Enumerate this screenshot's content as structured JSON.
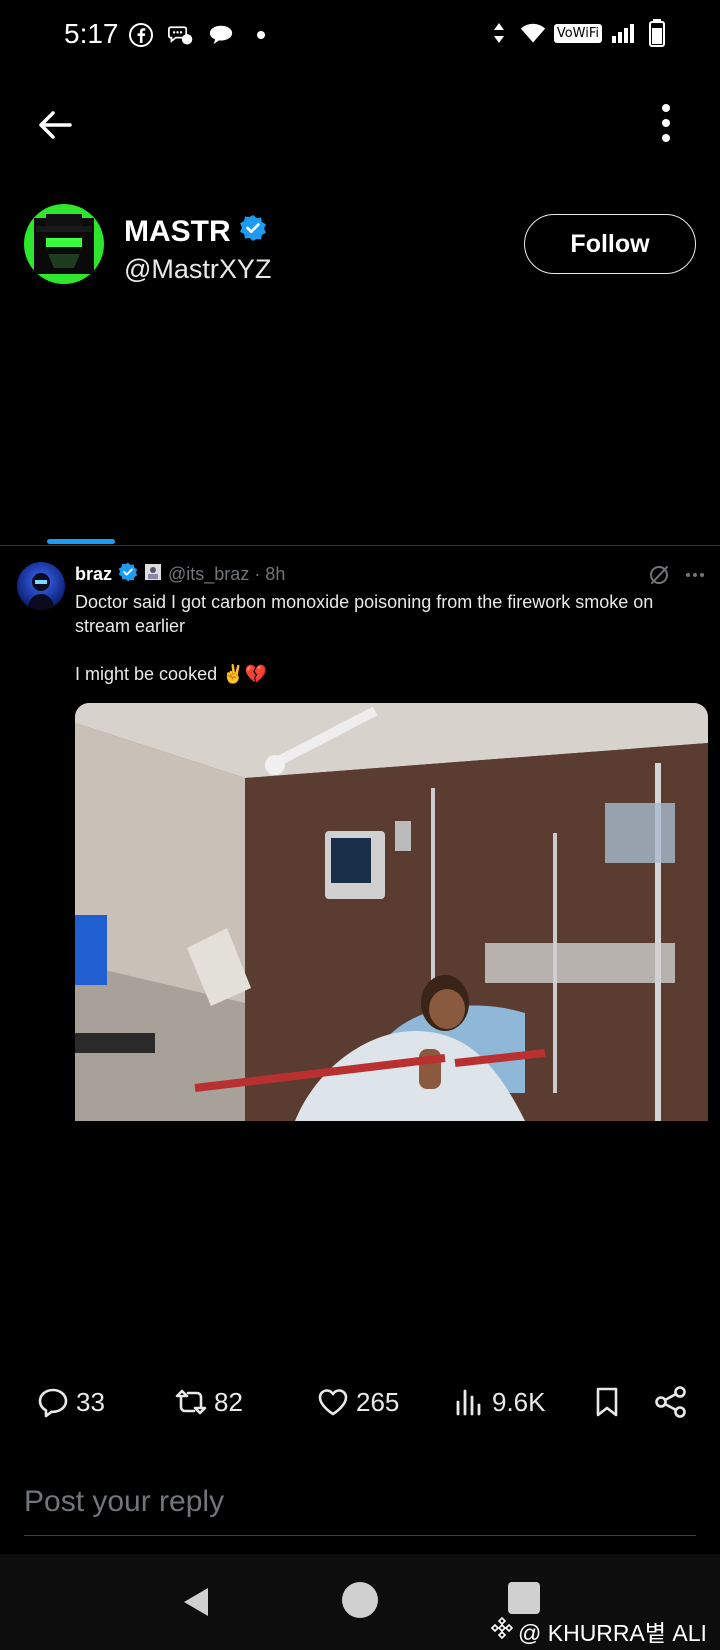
{
  "status_bar": {
    "time": "5:17",
    "network_label": "VoWiFi"
  },
  "profile": {
    "name": "MASTR",
    "handle": "@MastrXYZ",
    "follow_label": "Follow"
  },
  "tweet": {
    "author_name": "braz",
    "handle_time": "@its_braz · 8h",
    "text_line1": "Doctor said I got carbon monoxide poisoning from the firework smoke on stream earlier",
    "text_line2": "I might be cooked ✌️💔"
  },
  "engagement": {
    "replies": "33",
    "reposts": "82",
    "likes": "265",
    "views": "9.6K"
  },
  "reply": {
    "placeholder": "Post your reply"
  },
  "watermark": {
    "text": "@ KHURRA볕 ALI"
  },
  "colors": {
    "accent": "#1d9bf0",
    "background": "#000000",
    "muted": "#71767b"
  },
  "icons": [
    "back-arrow-icon",
    "more-vertical-icon",
    "verified-badge-icon",
    "grok-icon",
    "more-horizontal-icon",
    "reply-icon",
    "repost-icon",
    "like-icon",
    "views-icon",
    "bookmark-icon",
    "share-icon"
  ]
}
